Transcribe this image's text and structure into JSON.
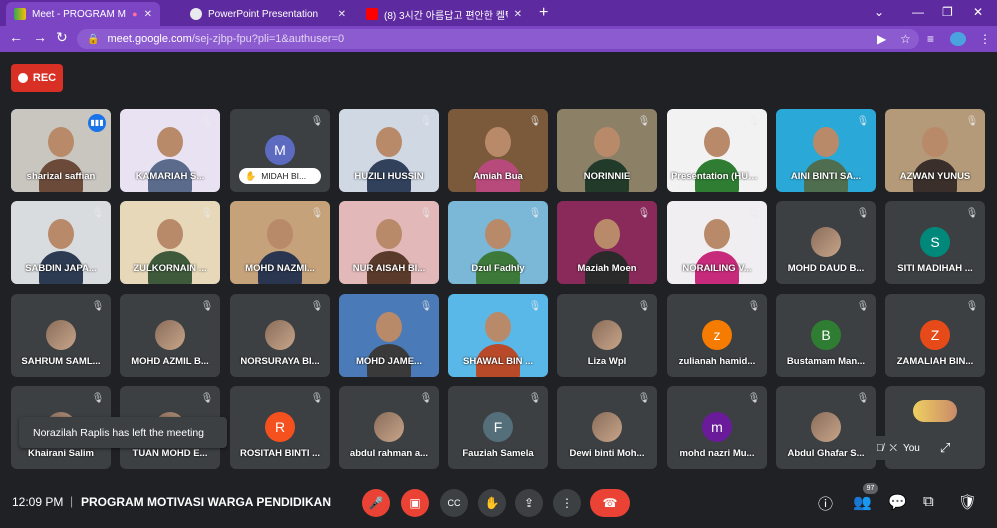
{
  "browser": {
    "tabs": [
      {
        "title": "Meet - PROGRAM MOTIVASI",
        "icon": "google-meet-icon"
      },
      {
        "title": "PowerPoint Presentation",
        "icon": "globe-icon"
      },
      {
        "title": "(8) 3시간 아름답고 편안한 켈틱음",
        "icon": "youtube-icon"
      }
    ],
    "url_host": "meet.google.com",
    "url_path": "/sej-zjbp-fpu?pli=1&authuser=0"
  },
  "meet": {
    "rec_label": "REC",
    "toast": "Norazilah Raplis has left the meeting",
    "self_label": "You",
    "participants": [
      {
        "name": "sharizal saffian",
        "kind": "video",
        "tone": "#6b4a3a",
        "bg": "#c9c6c0",
        "speaking": true
      },
      {
        "name": "KAMARIAH S...",
        "kind": "video",
        "tone": "#5a6b8c",
        "bg": "#e9e2f2"
      },
      {
        "name": "MIDAH BI...",
        "kind": "pill",
        "letter": "M",
        "color": "#5c6bc0"
      },
      {
        "name": "HUZILI HUSSIN",
        "kind": "video",
        "tone": "#31415c",
        "bg": "#cfd8e3"
      },
      {
        "name": "Amiah Bua",
        "kind": "video",
        "tone": "#b74a7a",
        "bg": "#7a5a3a"
      },
      {
        "name": "NORINNIE",
        "kind": "video",
        "tone": "#223a2a",
        "bg": "#8c8067"
      },
      {
        "name": "Presentation (HUZILI HUSSI...",
        "kind": "video",
        "tone": "#2e7d32",
        "bg": "#f2f2f2"
      },
      {
        "name": "AINI BINTI SA...",
        "kind": "video",
        "tone": "#4f6d4f",
        "bg": "#2aa8d8"
      },
      {
        "name": "AZWAN YUNUS",
        "kind": "video",
        "tone": "#3a2f2a",
        "bg": "#b49a78"
      },
      {
        "name": "SABDIN JAPA...",
        "kind": "video",
        "tone": "#2d3b52",
        "bg": "#d9dcde"
      },
      {
        "name": "ZULKORNAIN ...",
        "kind": "video",
        "tone": "#3e5a3a",
        "bg": "#e6d8b8"
      },
      {
        "name": "MOHD NAZMI...",
        "kind": "video",
        "tone": "#2a3550",
        "bg": "#c6a27a"
      },
      {
        "name": "NUR AISAH BI...",
        "kind": "video",
        "tone": "#5a3a2a",
        "bg": "#e2b8b8"
      },
      {
        "name": "Dzul Fadhly",
        "kind": "video",
        "tone": "#3d7a3a",
        "bg": "#7bb8d8"
      },
      {
        "name": "Maziah Moen",
        "kind": "video",
        "tone": "#2a2a2a",
        "bg": "#8a2a5a"
      },
      {
        "name": "NORAILING V...",
        "kind": "video",
        "tone": "#c72a7a",
        "bg": "#f0eef0"
      },
      {
        "name": "MOHD DAUD B...",
        "kind": "avatar-photo"
      },
      {
        "name": "SITI MADIHAH ...",
        "kind": "letter",
        "letter": "S",
        "color": "#00897b"
      },
      {
        "name": "SAHRUM SAML...",
        "kind": "avatar-photo"
      },
      {
        "name": "MOHD AZMIL B...",
        "kind": "avatar-photo"
      },
      {
        "name": "NORSURAYA BI...",
        "kind": "avatar-photo"
      },
      {
        "name": "MOHD JAME...",
        "kind": "video",
        "tone": "#3a3a3a",
        "bg": "#4a7ab8"
      },
      {
        "name": "SHAWAL BIN ...",
        "kind": "video",
        "tone": "#b84a2a",
        "bg": "#5ab8e8"
      },
      {
        "name": "Liza Wpl",
        "kind": "avatar-photo"
      },
      {
        "name": "zulianah hamid...",
        "kind": "letter",
        "letter": "z",
        "color": "#f57c00"
      },
      {
        "name": "Bustamam Man...",
        "kind": "letter",
        "letter": "B",
        "color": "#2e7d32"
      },
      {
        "name": "ZAMALIAH BIN...",
        "kind": "letter",
        "letter": "Z",
        "color": "#e64a19"
      },
      {
        "name": "Khairani Salim",
        "kind": "avatar-photo"
      },
      {
        "name": "TUAN MOHD E...",
        "kind": "avatar-photo"
      },
      {
        "name": "ROSITAH BINTI ...",
        "kind": "letter",
        "letter": "R",
        "color": "#f4511e"
      },
      {
        "name": "abdul rahman a...",
        "kind": "avatar-photo"
      },
      {
        "name": "Fauziah Samela",
        "kind": "letter",
        "letter": "F",
        "color": "#546e7a"
      },
      {
        "name": "Dewi binti Moh...",
        "kind": "avatar-photo"
      },
      {
        "name": "mohd nazri Mu...",
        "kind": "letter",
        "letter": "m",
        "color": "#6a1b9a"
      },
      {
        "name": "Abdul Ghafar S...",
        "kind": "avatar-photo"
      },
      {
        "name": "",
        "kind": "self"
      }
    ]
  },
  "bottom": {
    "time": "12:09 PM",
    "separator": "|",
    "meeting_title": "PROGRAM MOTIVASI WARGA PENDIDIKAN ...",
    "participant_count": "97"
  }
}
